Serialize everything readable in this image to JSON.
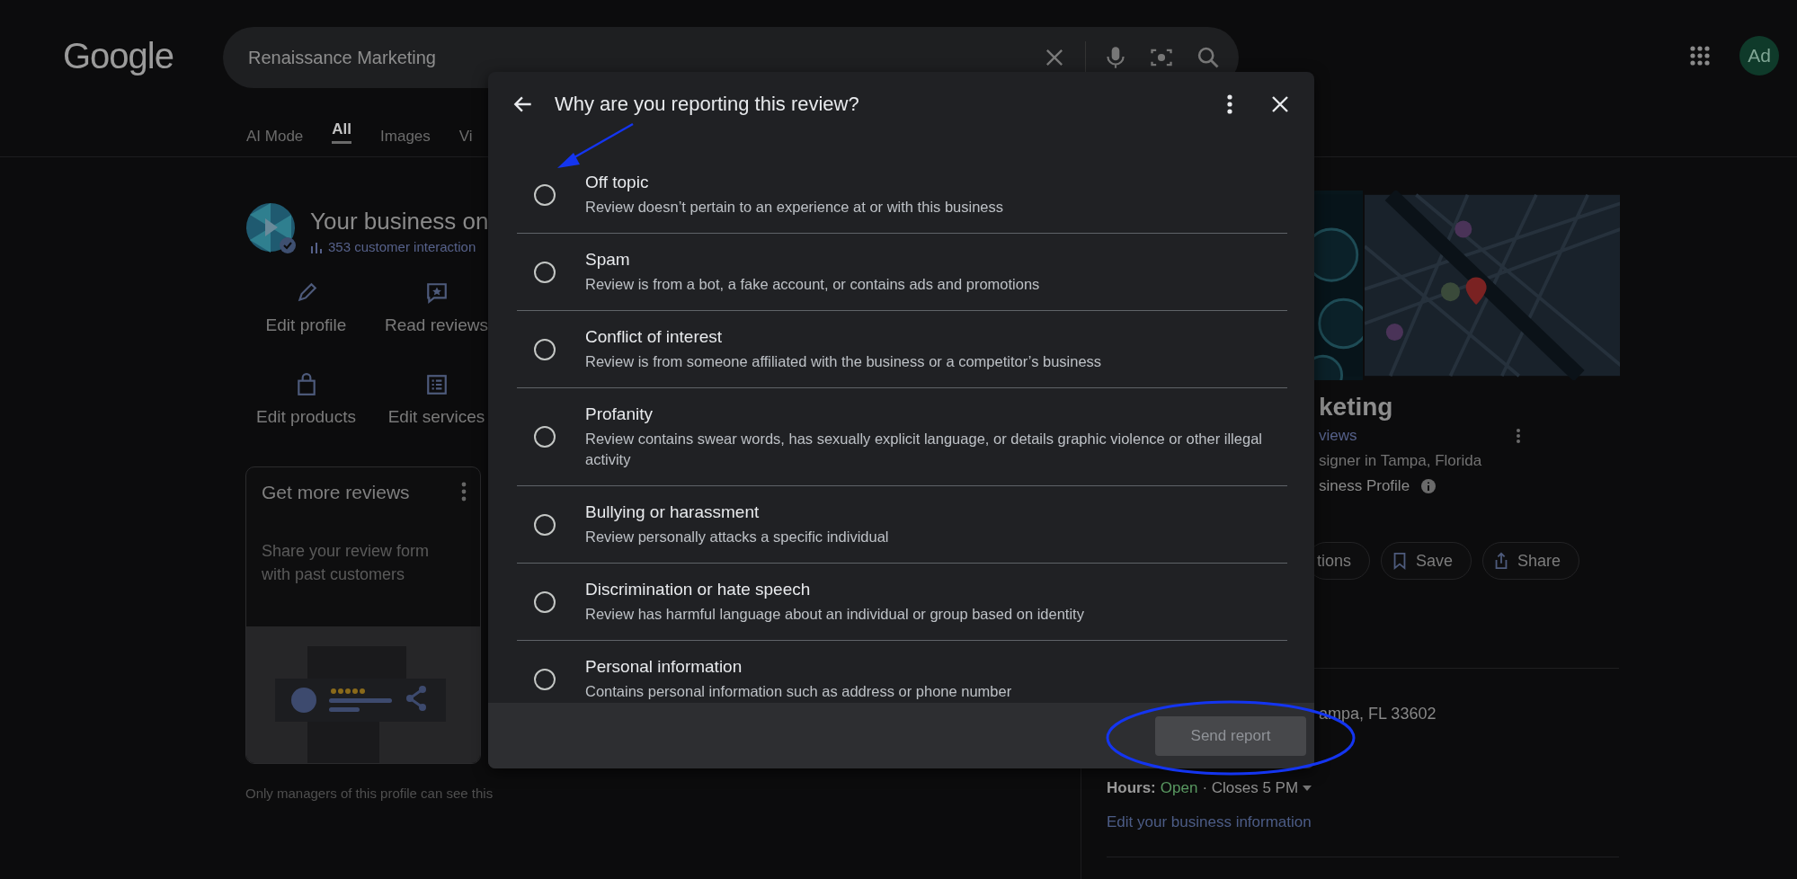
{
  "header": {
    "logo": "Google",
    "search": {
      "value": "Renaissance Marketing"
    },
    "avatar": "Ad"
  },
  "tabs": [
    {
      "label": "AI Mode",
      "selected": false
    },
    {
      "label": "All",
      "selected": true
    },
    {
      "label": "Images",
      "selected": false
    },
    {
      "label": "Vi",
      "selected": false
    }
  ],
  "business_card": {
    "title": "Your business on",
    "stats": "353 customer interaction",
    "actions": [
      {
        "label": "Edit profile"
      },
      {
        "label": "Read reviews"
      },
      {
        "label": "Edit products"
      },
      {
        "label": "Edit services"
      }
    ],
    "promo": {
      "title": "Get more reviews",
      "text": "Share your review form with past customers"
    },
    "note": "Only managers of this profile can see this"
  },
  "knowledge_panel": {
    "title": "keting",
    "reviews_link": "views",
    "category": "signer in Tampa, Florida",
    "profile_label": "siness Profile",
    "buttons": [
      {
        "label": "tions"
      },
      {
        "label": "Save"
      },
      {
        "label": "Share"
      }
    ],
    "address": "ampa, FL 33602",
    "hours": {
      "label": "Hours:",
      "status": "Open",
      "detail": "· Closes 5 PM"
    },
    "edit_link": "Edit your business information"
  },
  "dialog": {
    "title": "Why are you reporting this review?",
    "options": [
      {
        "label": "Off topic",
        "description": "Review doesn’t pertain to an experience at or with this business",
        "selected": false
      },
      {
        "label": "Spam",
        "description": "Review is from a bot, a fake account, or contains ads and promotions",
        "selected": false
      },
      {
        "label": "Conflict of interest",
        "description": "Review is from someone affiliated with the business or a competitor’s business",
        "selected": false
      },
      {
        "label": "Profanity",
        "description": "Review contains swear words, has sexually explicit language, or details graphic violence or other illegal activity",
        "selected": false
      },
      {
        "label": "Bullying or harassment",
        "description": "Review personally attacks a specific individual",
        "selected": false
      },
      {
        "label": "Discrimination or hate speech",
        "description": "Review has harmful language about an individual or group based on identity",
        "selected": false
      },
      {
        "label": "Personal information",
        "description": "Contains personal information such as address or phone number",
        "selected": false
      }
    ],
    "submit": {
      "label": "Send report",
      "disabled": true
    }
  }
}
